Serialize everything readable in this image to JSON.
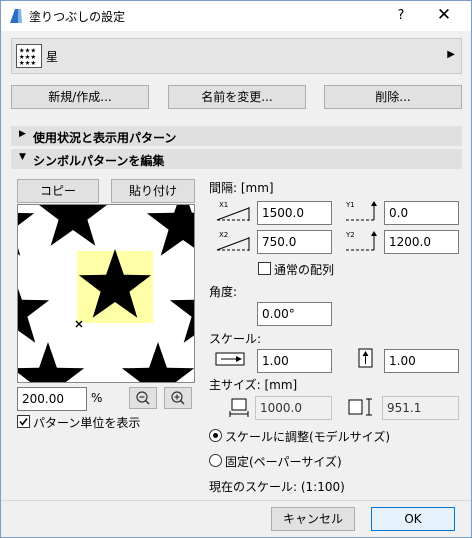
{
  "window": {
    "title": "塗りつぶしの設定",
    "help_label": "?",
    "close_label": "✕"
  },
  "selector": {
    "name": "星",
    "arrow": "▶"
  },
  "buttons": {
    "new": "新規/作成...",
    "rename": "名前を変更...",
    "delete": "削除...",
    "copy": "コピー",
    "paste": "貼り付け",
    "cancel": "キャンセル",
    "ok": "OK"
  },
  "sections": {
    "usage": {
      "label": "使用状況と表示用パターン",
      "icon": "triangle-right-icon",
      "expanded": false
    },
    "symbol": {
      "label": "シンボルパターンを編集",
      "icon": "triangle-down-icon",
      "expanded": true
    }
  },
  "spacing": {
    "label": "間隔: [mm]",
    "x1": {
      "tag": "X1",
      "value": "1500.0"
    },
    "y1": {
      "tag": "Y1",
      "value": "0.0"
    },
    "x2": {
      "tag": "X2",
      "value": "750.0"
    },
    "y2": {
      "tag": "Y2",
      "value": "1200.0"
    },
    "regular_label": "通常の配列",
    "regular_checked": false
  },
  "angle": {
    "label": "角度:",
    "value": "0.00°"
  },
  "scale": {
    "label": "スケール:",
    "x_value": "1.00",
    "y_value": "1.00"
  },
  "main_size": {
    "label": "主サイズ: [mm]",
    "width": "1000.0",
    "height": "951.1"
  },
  "preview": {
    "zoom": "200.00",
    "unit": "%",
    "show_unit_label": "パターン単位を表示",
    "show_unit_checked": true,
    "highlight_color": "#ffffa8",
    "star_color": "#000000"
  },
  "scaling_mode": {
    "fit_label": "スケールに調整(モデルサイズ)",
    "fixed_label": "固定(ペーパーサイズ)",
    "selected": "fit"
  },
  "current_scale": {
    "label": "現在のスケール: (1:100)"
  }
}
